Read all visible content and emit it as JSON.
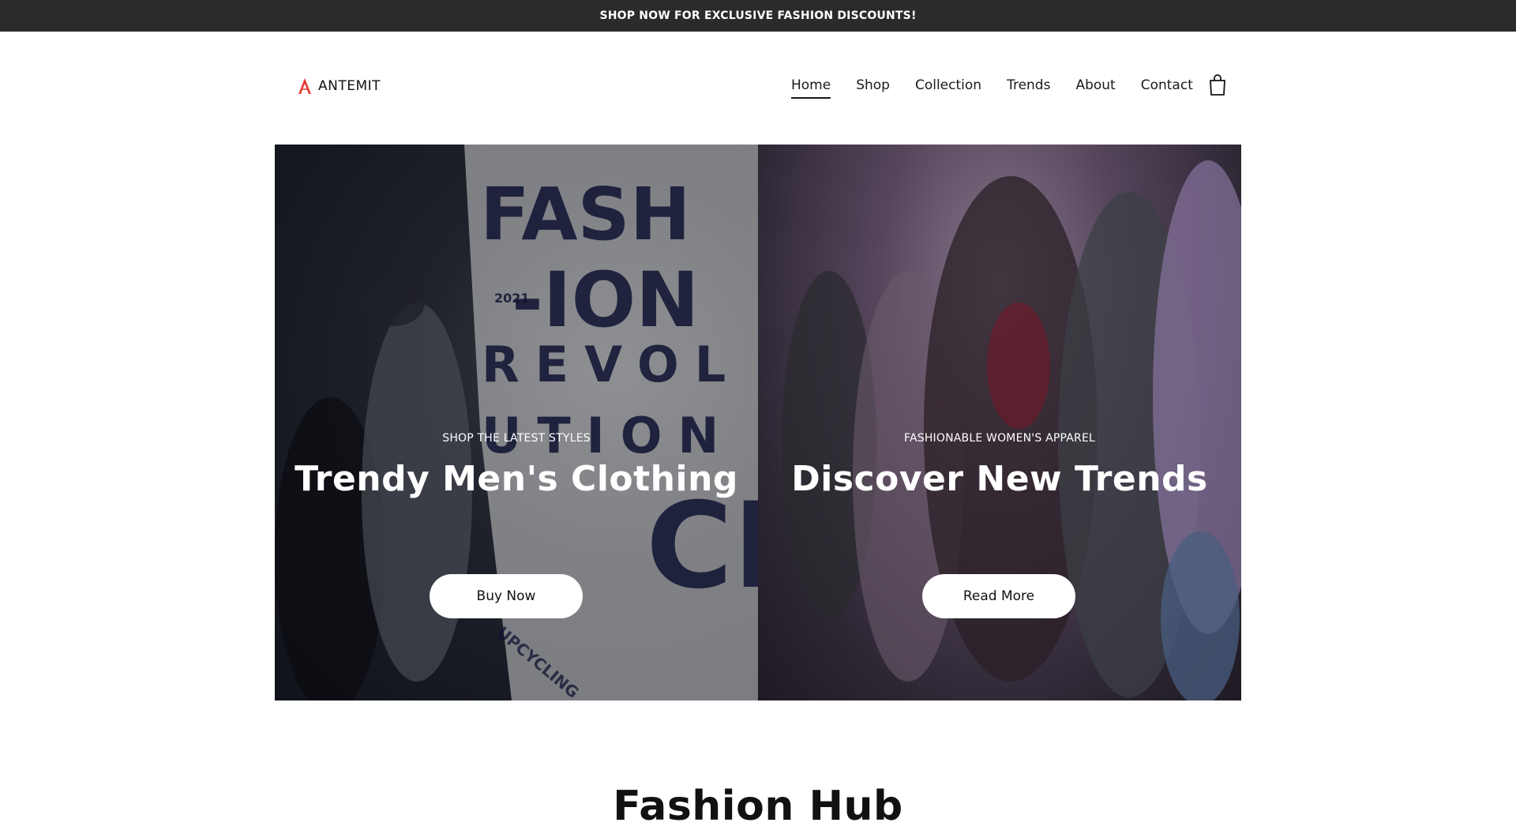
{
  "announcement": {
    "text": "SHOP NOW FOR EXCLUSIVE FASHION DISCOUNTS!"
  },
  "brand": {
    "name": "ANTEMIT",
    "accent_color": "#e53935"
  },
  "nav": {
    "items": [
      {
        "label": "Home",
        "active": true
      },
      {
        "label": "Shop"
      },
      {
        "label": "Collection"
      },
      {
        "label": "Trends"
      },
      {
        "label": "About"
      },
      {
        "label": "Contact"
      }
    ],
    "cart_icon": "shopping-bag-icon"
  },
  "hero": {
    "left": {
      "eyebrow": "SHOP THE LATEST STYLES",
      "headline": "Trendy Men's Clothing",
      "button": "Buy Now",
      "image_text": {
        "line1": "FASH",
        "line2": "-ION",
        "line3": "REVOL",
        "line4": "UTION",
        "year": "2021",
        "bottom": "UPCYCLING"
      }
    },
    "right": {
      "eyebrow": "FASHIONABLE WOMEN'S APPAREL",
      "headline": "Discover New Trends",
      "button": "Read More"
    }
  },
  "section": {
    "title": "Fashion Hub"
  }
}
